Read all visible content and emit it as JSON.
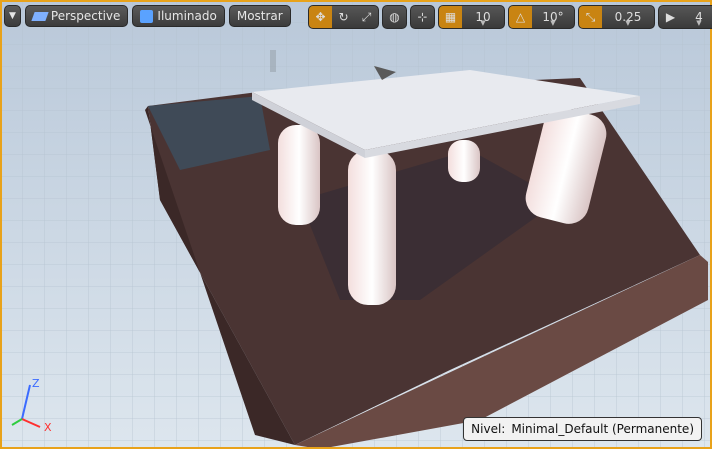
{
  "toolbar": {
    "perspective_label": "Perspective",
    "lit_label": "Iluminado",
    "show_label": "Mostrar",
    "grid_snap_value": "10",
    "rotation_snap_value": "10°",
    "scale_snap_value": "0.25",
    "camera_speed_value": "4"
  },
  "status": {
    "level_label": "Nivel:",
    "level_value": "Minimal_Default (Permanente)"
  },
  "axes": {
    "z": "Z",
    "x": "X"
  },
  "colors": {
    "accent": "#e8a21a",
    "active_tool": "#c98412"
  }
}
